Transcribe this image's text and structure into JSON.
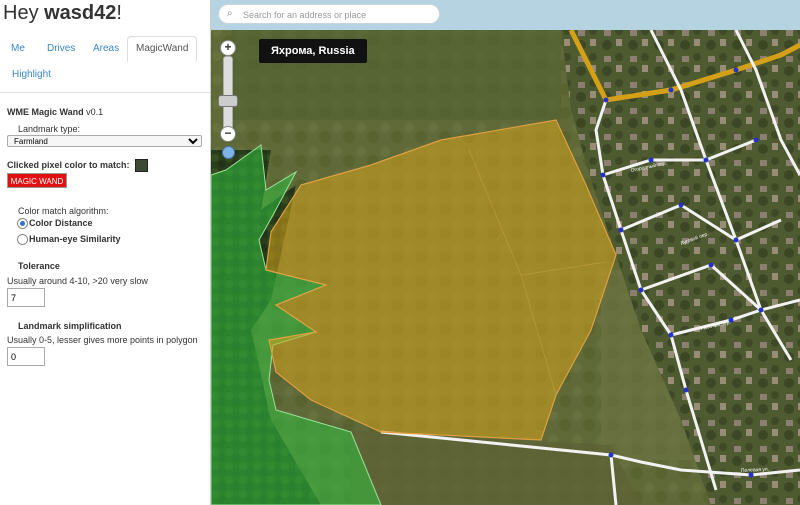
{
  "header": {
    "greeting_prefix": "Hey ",
    "username": "wasd42",
    "greeting_suffix": "!"
  },
  "tabs": [
    {
      "label": "Me"
    },
    {
      "label": "Drives"
    },
    {
      "label": "Areas"
    },
    {
      "label": "MagicWand",
      "active": true
    },
    {
      "label": "Highlight"
    }
  ],
  "panel": {
    "title": "WME Magic Wand",
    "version": " v0.1",
    "landmark_type_label": "Landmark type:",
    "landmark_type_value": "Farmland",
    "clicked_color_label": "Clicked pixel color to match:",
    "clicked_color_hex": "#3d4b32",
    "magic_wand_button": "MAGIC WAND",
    "algorithm_label": "Color match algorithm:",
    "algorithms": [
      {
        "label": "Color Distance",
        "checked": true
      },
      {
        "label": "Human-eye Similarity",
        "checked": false
      }
    ],
    "tolerance_title": "Tolerance",
    "tolerance_hint": "Usually around 4-10, >20 very slow",
    "tolerance_value": "7",
    "simplification_title": "Landmark simplification",
    "simplification_hint": "Usually 0-5, lesser gives more points in polygon",
    "simplification_value": "0"
  },
  "map": {
    "search_placeholder": "Search for an address or place",
    "location_label": "Яхрома, Russia",
    "zoom_in": "+",
    "zoom_out": "−"
  },
  "colors": {
    "farmland_fill": "#d4a21c",
    "forest_fill": "#2fbf3f",
    "road": "#f2f2f2",
    "highway": "#d4a017",
    "node": "#2233cc"
  }
}
